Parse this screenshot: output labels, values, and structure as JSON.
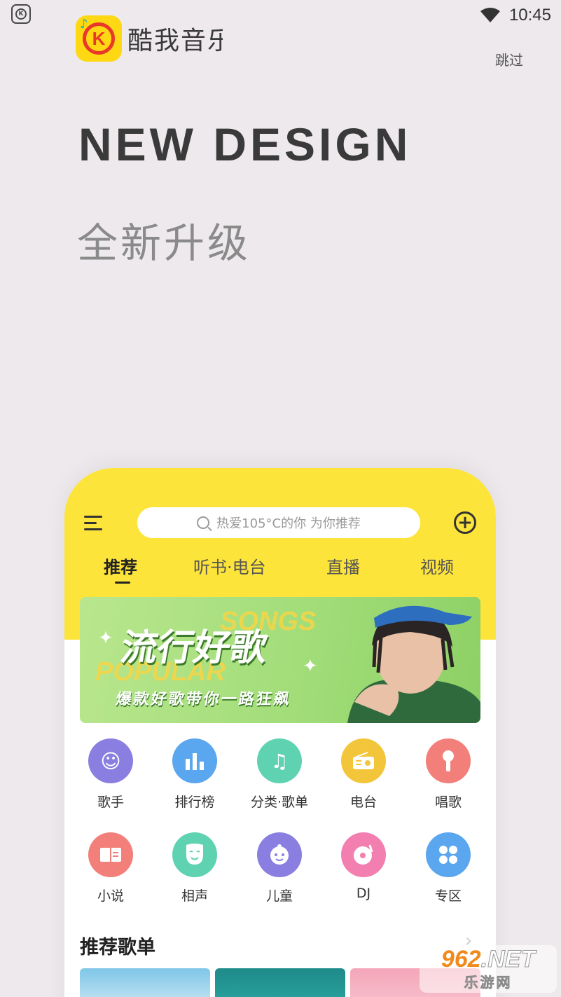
{
  "status_bar": {
    "time": "10:45"
  },
  "logo": {
    "text": "酷我音乐",
    "letter": "K"
  },
  "skip_label": "跳过",
  "headline": "NEW DESIGN",
  "subheadline": "全新升级",
  "mockup": {
    "search_placeholder": "热爱105°C的你  为你推荐",
    "tabs": [
      {
        "label": "推荐",
        "active": true
      },
      {
        "label": "听书·电台",
        "active": false
      },
      {
        "label": "直播",
        "active": false
      },
      {
        "label": "视频",
        "active": false
      }
    ],
    "banner": {
      "title": "流行好歌",
      "ghost_songs": "SONGS",
      "ghost_popular": "POPULAR",
      "tagline": "爆款好歌带你一路狂飙"
    },
    "grid_row1": [
      {
        "label": "歌手",
        "icon": "singer-icon",
        "color": "#8a7fe0"
      },
      {
        "label": "排行榜",
        "icon": "chart-icon",
        "color": "#5aa6ef"
      },
      {
        "label": "分类·歌单",
        "icon": "category-icon",
        "color": "#5fd2b1"
      },
      {
        "label": "电台",
        "icon": "radio-icon",
        "color": "#f3c53a"
      },
      {
        "label": "唱歌",
        "icon": "microphone-icon",
        "color": "#f27f7a"
      }
    ],
    "grid_row2": [
      {
        "label": "小说",
        "icon": "book-icon",
        "color": "#f27f7a"
      },
      {
        "label": "相声",
        "icon": "mask-icon",
        "color": "#5fd2b1"
      },
      {
        "label": "儿童",
        "icon": "child-icon",
        "color": "#8a7fe0"
      },
      {
        "label": "DJ",
        "icon": "vinyl-icon",
        "color": "#f27fb0"
      },
      {
        "label": "专区",
        "icon": "grid-icon",
        "color": "#5aa6ef"
      }
    ],
    "section_title": "推荐歌单"
  },
  "watermark": {
    "top_num": "962",
    "top_net": ".NET",
    "bottom": "乐游网"
  }
}
